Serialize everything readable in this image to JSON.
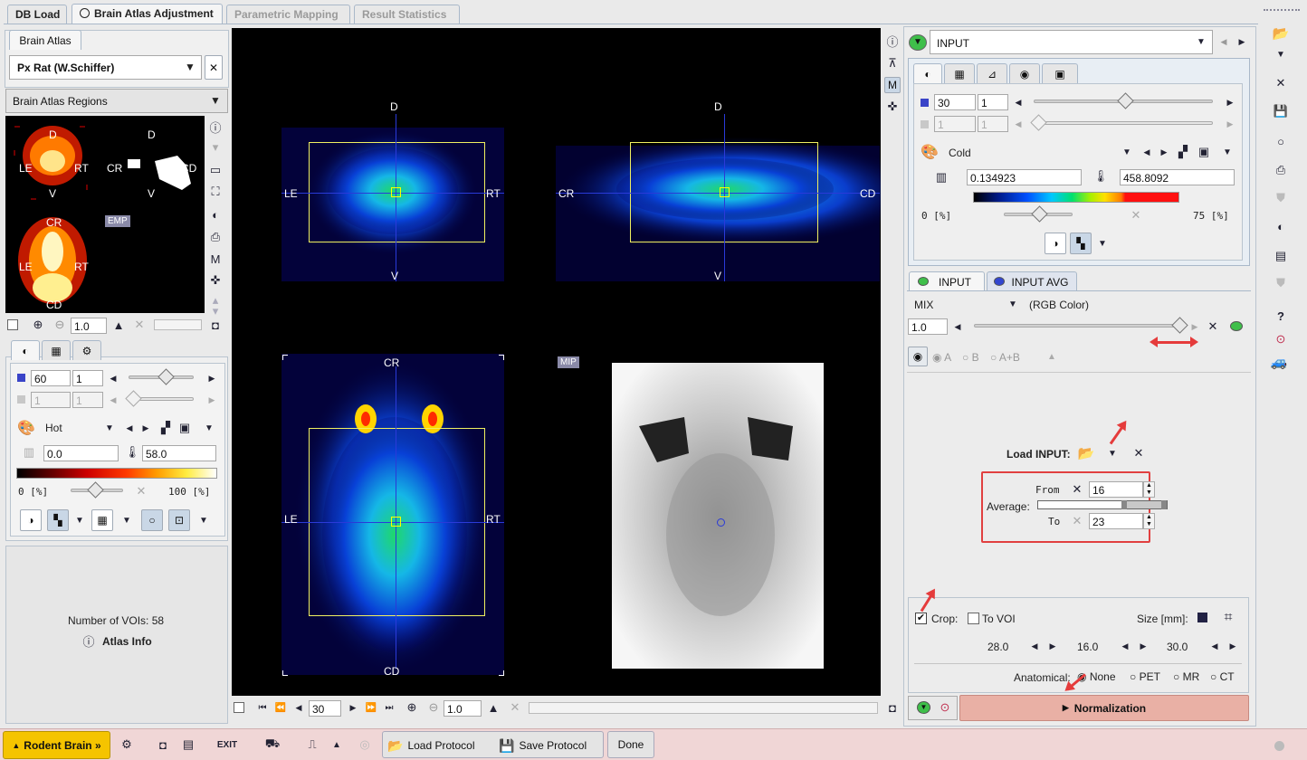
{
  "tabs": [
    "DB Load",
    "Brain Atlas Adjustment",
    "Parametric Mapping",
    "Result Statistics"
  ],
  "left": {
    "atlas_tab": "Brain Atlas",
    "atlas_select": "Px Rat (W.Schiffer)",
    "regions_select": "Brain Atlas Regions",
    "thumb_labels": {
      "d": "D",
      "v": "V",
      "le": "LE",
      "rt": "RT",
      "cr": "CR",
      "cd": "CD",
      "emp": "EMP"
    },
    "zoom_value": "1.0",
    "frame_value": "60",
    "frame_step": "1",
    "frame2_value": "1",
    "frame2_step": "1",
    "colormap": "Hot",
    "range_min": "0.0",
    "range_max": "58.0",
    "pct_min": "0 [%]",
    "pct_max": "100 [%]",
    "voi_count": "Number of VOIs: 58",
    "atlas_info": "Atlas Info"
  },
  "viewer": {
    "axial": {
      "top": "D",
      "bottom": "V",
      "left": "LE",
      "right": "RT"
    },
    "sagittal": {
      "top": "D",
      "bottom": "V",
      "left": "CR",
      "right": "CD"
    },
    "coronal": {
      "top": "CR",
      "bottom": "CD",
      "left": "LE",
      "right": "RT"
    },
    "mip_label": "MIP",
    "plane_value": "30",
    "zoom_value": "1.0"
  },
  "right": {
    "input_select": "INPUT",
    "frame_value": "30",
    "frame_step": "1",
    "frame2_value": "1",
    "frame2_step": "1",
    "colormap": "Cold",
    "range_min": "0.134923",
    "range_max": "458.8092",
    "pct_min": "0 [%]",
    "pct_max": "75 [%]",
    "input_tabs": [
      "INPUT",
      "INPUT AVG"
    ],
    "mix_label": "MIX",
    "mix_mode": "(RGB Color)",
    "mix_value": "1.0",
    "radio_a": "A",
    "radio_b": "B",
    "radio_ab": "A+B",
    "load_input": "Load INPUT:",
    "from_label": "From",
    "from_value": "16",
    "average_label": "Average:",
    "to_label": "To",
    "to_value": "23",
    "crop_label": "Crop:",
    "to_voi_label": "To VOI",
    "size_label": "Size [mm]:",
    "size_x": "28.0",
    "size_y": "16.0",
    "size_z": "30.0",
    "anatomical_label": "Anatomical:",
    "anat_none": "None",
    "anat_pet": "PET",
    "anat_mr": "MR",
    "anat_ct": "CT",
    "normalization": "Normalization"
  },
  "bottom": {
    "rodent_brain": "Rodent Brain »",
    "load_protocol": "Load Protocol",
    "save_protocol": "Save Protocol",
    "done": "Done"
  },
  "colors": {
    "accent_tab_border": "#a9b8c9",
    "rodent_button": "#f5c400",
    "normalization_bg": "#e9b0a5",
    "annotation_red": "#e53b3b",
    "crosshair_blue": "#2a3ad8",
    "bottom_bar": "#f0d6d6"
  }
}
